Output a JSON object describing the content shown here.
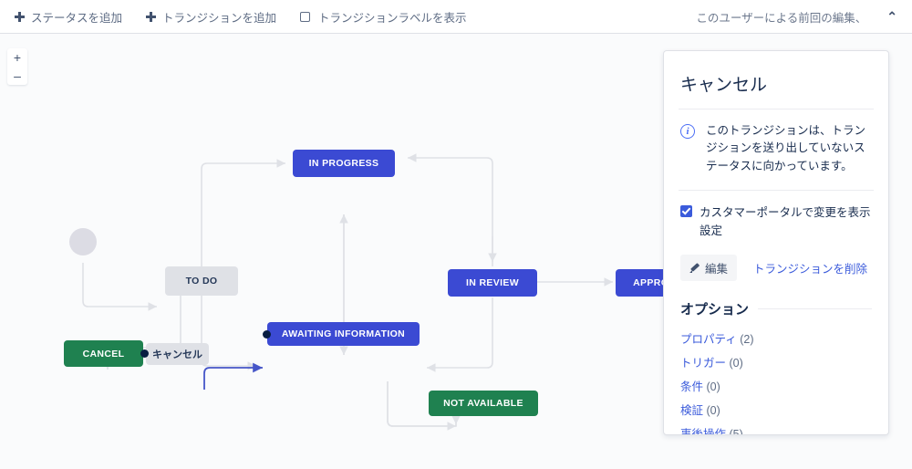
{
  "toolbar": {
    "add_status_label": "ステータスを追加",
    "add_transition_label": "トランジションを追加",
    "show_transition_labels_label": "トランジションラベルを表示",
    "show_transition_labels_checked": false,
    "last_edited_label": "このユーザーによる前回の編集、",
    "collapse_icon": "⌃"
  },
  "zoom_controls": {
    "zoom_in": "+",
    "zoom_out": "–"
  },
  "diagram": {
    "nodes": [
      {
        "id": "start",
        "label": "",
        "kind": "start"
      },
      {
        "id": "todo",
        "label": "TO DO",
        "kind": "gray"
      },
      {
        "id": "inprogress",
        "label": "IN PROGRESS",
        "kind": "blue"
      },
      {
        "id": "inreview",
        "label": "IN REVIEW",
        "kind": "blue"
      },
      {
        "id": "approved",
        "label": "APPROVED",
        "kind": "blue"
      },
      {
        "id": "awaiting",
        "label": "AWAITING INFORMATION",
        "kind": "blue"
      },
      {
        "id": "cancel",
        "label": "CANCEL",
        "kind": "green"
      },
      {
        "id": "notavail",
        "label": "NOT AVAILABLE",
        "kind": "green"
      }
    ],
    "selected_edge_label": "キャンセル",
    "colors": {
      "blue": "#3b4ad3",
      "green": "#1f8150",
      "gray": "#dfe1e6",
      "edge": "#dfe1e6",
      "selected_edge": "#4656c8",
      "canvas": "#fafbfc"
    }
  },
  "panel": {
    "title": "キャンセル",
    "info_text": "このトランジションは、トランジションを送り出していないステータスに向かっています。",
    "info_icon": "i",
    "portal_checkbox_label": "カスタマーポータルで変更を表示設定",
    "portal_checkbox_checked": true,
    "edit_button": "編集",
    "delete_transition_link": "トランジションを削除",
    "options_title": "オプション",
    "options": [
      {
        "label": "プロパティ",
        "count": "(2)"
      },
      {
        "label": "トリガー",
        "count": "(0)"
      },
      {
        "label": "条件",
        "count": "(0)"
      },
      {
        "label": "検証",
        "count": "(0)"
      },
      {
        "label": "事後操作",
        "count": "(5)"
      }
    ]
  }
}
